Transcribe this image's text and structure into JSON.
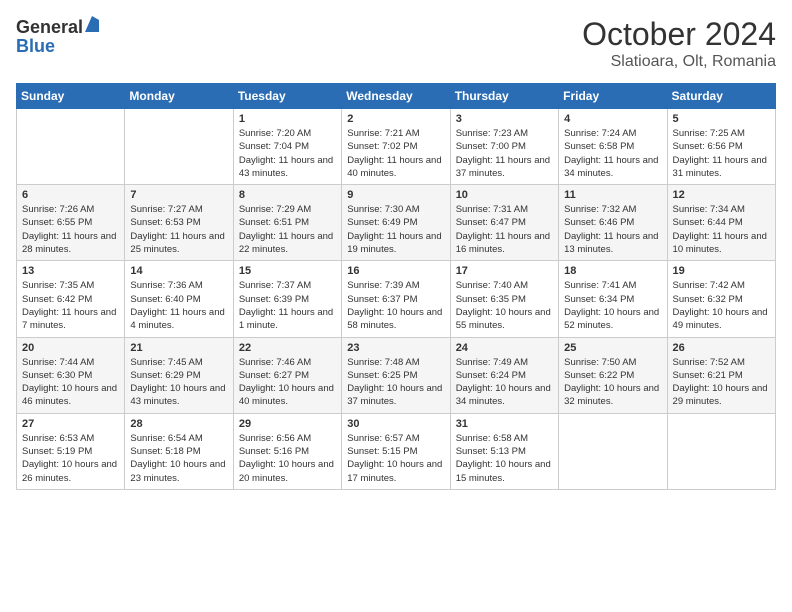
{
  "header": {
    "logo_general": "General",
    "logo_blue": "Blue",
    "month_title": "October 2024",
    "location": "Slatioara, Olt, Romania"
  },
  "weekdays": [
    "Sunday",
    "Monday",
    "Tuesday",
    "Wednesday",
    "Thursday",
    "Friday",
    "Saturday"
  ],
  "weeks": [
    [
      {
        "day": "",
        "detail": ""
      },
      {
        "day": "",
        "detail": ""
      },
      {
        "day": "1",
        "detail": "Sunrise: 7:20 AM\nSunset: 7:04 PM\nDaylight: 11 hours and 43 minutes."
      },
      {
        "day": "2",
        "detail": "Sunrise: 7:21 AM\nSunset: 7:02 PM\nDaylight: 11 hours and 40 minutes."
      },
      {
        "day": "3",
        "detail": "Sunrise: 7:23 AM\nSunset: 7:00 PM\nDaylight: 11 hours and 37 minutes."
      },
      {
        "day": "4",
        "detail": "Sunrise: 7:24 AM\nSunset: 6:58 PM\nDaylight: 11 hours and 34 minutes."
      },
      {
        "day": "5",
        "detail": "Sunrise: 7:25 AM\nSunset: 6:56 PM\nDaylight: 11 hours and 31 minutes."
      }
    ],
    [
      {
        "day": "6",
        "detail": "Sunrise: 7:26 AM\nSunset: 6:55 PM\nDaylight: 11 hours and 28 minutes."
      },
      {
        "day": "7",
        "detail": "Sunrise: 7:27 AM\nSunset: 6:53 PM\nDaylight: 11 hours and 25 minutes."
      },
      {
        "day": "8",
        "detail": "Sunrise: 7:29 AM\nSunset: 6:51 PM\nDaylight: 11 hours and 22 minutes."
      },
      {
        "day": "9",
        "detail": "Sunrise: 7:30 AM\nSunset: 6:49 PM\nDaylight: 11 hours and 19 minutes."
      },
      {
        "day": "10",
        "detail": "Sunrise: 7:31 AM\nSunset: 6:47 PM\nDaylight: 11 hours and 16 minutes."
      },
      {
        "day": "11",
        "detail": "Sunrise: 7:32 AM\nSunset: 6:46 PM\nDaylight: 11 hours and 13 minutes."
      },
      {
        "day": "12",
        "detail": "Sunrise: 7:34 AM\nSunset: 6:44 PM\nDaylight: 11 hours and 10 minutes."
      }
    ],
    [
      {
        "day": "13",
        "detail": "Sunrise: 7:35 AM\nSunset: 6:42 PM\nDaylight: 11 hours and 7 minutes."
      },
      {
        "day": "14",
        "detail": "Sunrise: 7:36 AM\nSunset: 6:40 PM\nDaylight: 11 hours and 4 minutes."
      },
      {
        "day": "15",
        "detail": "Sunrise: 7:37 AM\nSunset: 6:39 PM\nDaylight: 11 hours and 1 minute."
      },
      {
        "day": "16",
        "detail": "Sunrise: 7:39 AM\nSunset: 6:37 PM\nDaylight: 10 hours and 58 minutes."
      },
      {
        "day": "17",
        "detail": "Sunrise: 7:40 AM\nSunset: 6:35 PM\nDaylight: 10 hours and 55 minutes."
      },
      {
        "day": "18",
        "detail": "Sunrise: 7:41 AM\nSunset: 6:34 PM\nDaylight: 10 hours and 52 minutes."
      },
      {
        "day": "19",
        "detail": "Sunrise: 7:42 AM\nSunset: 6:32 PM\nDaylight: 10 hours and 49 minutes."
      }
    ],
    [
      {
        "day": "20",
        "detail": "Sunrise: 7:44 AM\nSunset: 6:30 PM\nDaylight: 10 hours and 46 minutes."
      },
      {
        "day": "21",
        "detail": "Sunrise: 7:45 AM\nSunset: 6:29 PM\nDaylight: 10 hours and 43 minutes."
      },
      {
        "day": "22",
        "detail": "Sunrise: 7:46 AM\nSunset: 6:27 PM\nDaylight: 10 hours and 40 minutes."
      },
      {
        "day": "23",
        "detail": "Sunrise: 7:48 AM\nSunset: 6:25 PM\nDaylight: 10 hours and 37 minutes."
      },
      {
        "day": "24",
        "detail": "Sunrise: 7:49 AM\nSunset: 6:24 PM\nDaylight: 10 hours and 34 minutes."
      },
      {
        "day": "25",
        "detail": "Sunrise: 7:50 AM\nSunset: 6:22 PM\nDaylight: 10 hours and 32 minutes."
      },
      {
        "day": "26",
        "detail": "Sunrise: 7:52 AM\nSunset: 6:21 PM\nDaylight: 10 hours and 29 minutes."
      }
    ],
    [
      {
        "day": "27",
        "detail": "Sunrise: 6:53 AM\nSunset: 5:19 PM\nDaylight: 10 hours and 26 minutes."
      },
      {
        "day": "28",
        "detail": "Sunrise: 6:54 AM\nSunset: 5:18 PM\nDaylight: 10 hours and 23 minutes."
      },
      {
        "day": "29",
        "detail": "Sunrise: 6:56 AM\nSunset: 5:16 PM\nDaylight: 10 hours and 20 minutes."
      },
      {
        "day": "30",
        "detail": "Sunrise: 6:57 AM\nSunset: 5:15 PM\nDaylight: 10 hours and 17 minutes."
      },
      {
        "day": "31",
        "detail": "Sunrise: 6:58 AM\nSunset: 5:13 PM\nDaylight: 10 hours and 15 minutes."
      },
      {
        "day": "",
        "detail": ""
      },
      {
        "day": "",
        "detail": ""
      }
    ]
  ]
}
